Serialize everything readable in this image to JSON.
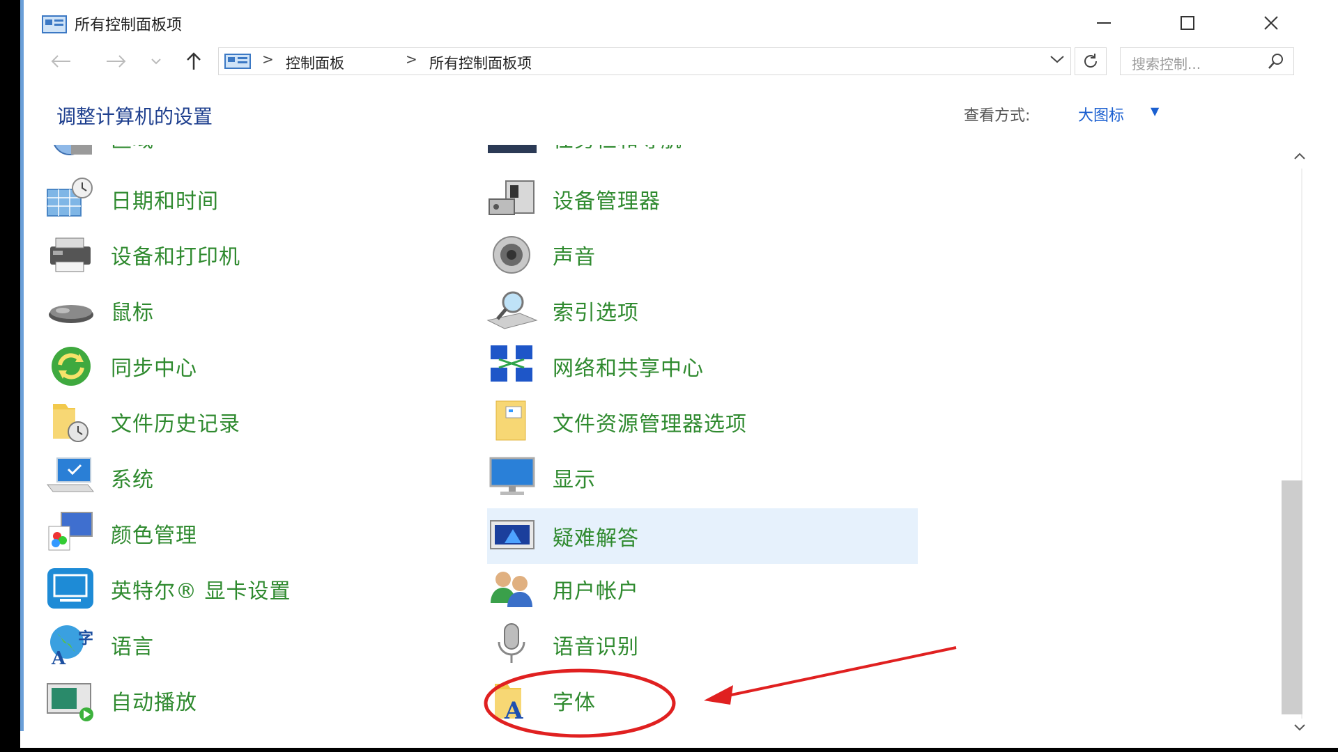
{
  "window": {
    "title": "所有控制面板项"
  },
  "address": {
    "crumbs": [
      "控制面板",
      "所有控制面板项"
    ],
    "separator": ">"
  },
  "search": {
    "placeholder": "搜索控制..."
  },
  "header": {
    "title": "调整计算机的设置",
    "view_label": "查看方式:",
    "view_value": "大图标"
  },
  "items_left": [
    {
      "label": "区域",
      "icon": "region-icon"
    },
    {
      "label": "日期和时间",
      "icon": "date-time-icon"
    },
    {
      "label": "设备和打印机",
      "icon": "printer-icon"
    },
    {
      "label": "鼠标",
      "icon": "mouse-icon"
    },
    {
      "label": "同步中心",
      "icon": "sync-icon"
    },
    {
      "label": "文件历史记录",
      "icon": "file-history-icon"
    },
    {
      "label": "系统",
      "icon": "system-icon"
    },
    {
      "label": "颜色管理",
      "icon": "color-management-icon"
    },
    {
      "label": "英特尔® 显卡设置",
      "icon": "intel-graphics-icon"
    },
    {
      "label": "语言",
      "icon": "language-icon"
    },
    {
      "label": "自动播放",
      "icon": "autoplay-icon"
    }
  ],
  "items_right": [
    {
      "label": "任务栏和导航",
      "icon": "taskbar-icon"
    },
    {
      "label": "设备管理器",
      "icon": "device-manager-icon"
    },
    {
      "label": "声音",
      "icon": "speaker-icon"
    },
    {
      "label": "索引选项",
      "icon": "indexing-icon"
    },
    {
      "label": "网络和共享中心",
      "icon": "network-icon"
    },
    {
      "label": "文件资源管理器选项",
      "icon": "folder-options-icon"
    },
    {
      "label": "显示",
      "icon": "display-icon"
    },
    {
      "label": "疑难解答",
      "icon": "troubleshooting-icon"
    },
    {
      "label": "用户帐户",
      "icon": "user-accounts-icon"
    },
    {
      "label": "语音识别",
      "icon": "microphone-icon"
    },
    {
      "label": "字体",
      "icon": "fonts-icon"
    }
  ],
  "colors": {
    "item_text": "#2f8a2f",
    "heading": "#1e3f8e",
    "link": "#1a5fd0",
    "highlight": "#e6f1fc",
    "annotation": "#e02020"
  }
}
